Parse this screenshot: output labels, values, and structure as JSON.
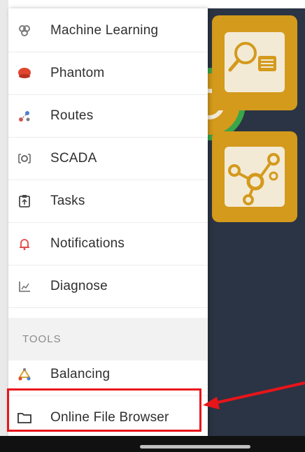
{
  "menu": {
    "items": [
      {
        "label": "Machine Learning",
        "icon": "brain-icon"
      },
      {
        "label": "Phantom",
        "icon": "phantom-icon"
      },
      {
        "label": "Routes",
        "icon": "routes-icon"
      },
      {
        "label": "SCADA",
        "icon": "scada-icon"
      },
      {
        "label": "Tasks",
        "icon": "tasks-icon"
      },
      {
        "label": "Notifications",
        "icon": "bell-icon"
      },
      {
        "label": "Diagnose",
        "icon": "chart-icon"
      }
    ],
    "section_tools": "TOOLS",
    "tools_items": [
      {
        "label": "Balancing",
        "icon": "balancing-icon"
      },
      {
        "label": "Online File Browser",
        "icon": "folder-icon"
      }
    ]
  },
  "colors": {
    "tile": "#d49a1c",
    "background": "#2b3444",
    "highlight": "#e8141a",
    "ring": "#3aa64a"
  }
}
